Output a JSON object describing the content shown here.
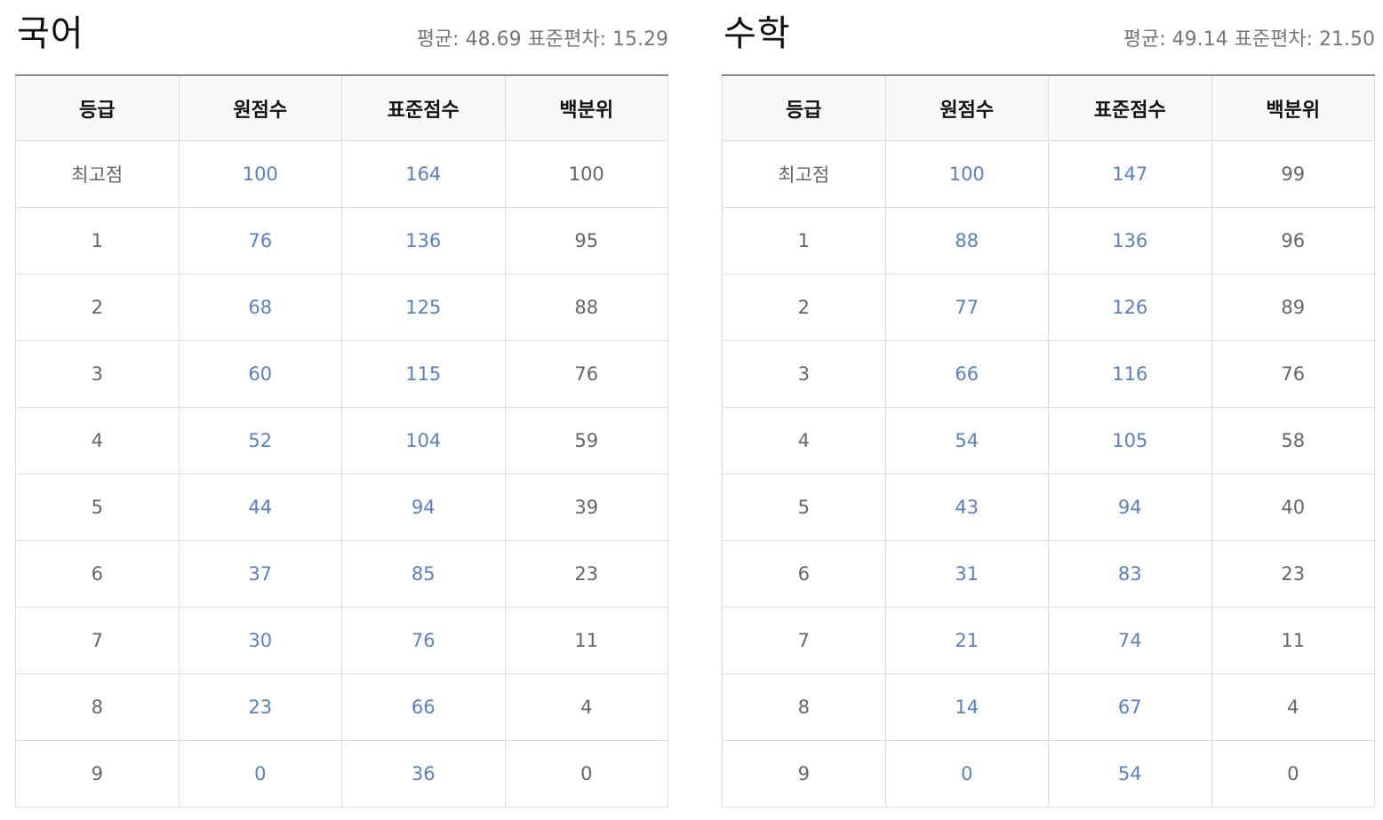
{
  "panels": [
    {
      "subject": "국어",
      "stats_mean_label": "평균: 48.69",
      "stats_sd_label": "표준편차: 15.29",
      "headers": [
        "등급",
        "원점수",
        "표준점수",
        "백분위"
      ],
      "rows": [
        [
          "최고점",
          "100",
          "164",
          "100"
        ],
        [
          "1",
          "76",
          "136",
          "95"
        ],
        [
          "2",
          "68",
          "125",
          "88"
        ],
        [
          "3",
          "60",
          "115",
          "76"
        ],
        [
          "4",
          "52",
          "104",
          "59"
        ],
        [
          "5",
          "44",
          "94",
          "39"
        ],
        [
          "6",
          "37",
          "85",
          "23"
        ],
        [
          "7",
          "30",
          "76",
          "11"
        ],
        [
          "8",
          "23",
          "66",
          "4"
        ],
        [
          "9",
          "0",
          "36",
          "0"
        ]
      ]
    },
    {
      "subject": "수학",
      "stats_mean_label": "평균: 49.14",
      "stats_sd_label": "표준편차: 21.50",
      "headers": [
        "등급",
        "원점수",
        "표준점수",
        "백분위"
      ],
      "rows": [
        [
          "최고점",
          "100",
          "147",
          "99"
        ],
        [
          "1",
          "88",
          "136",
          "96"
        ],
        [
          "2",
          "77",
          "126",
          "89"
        ],
        [
          "3",
          "66",
          "116",
          "76"
        ],
        [
          "4",
          "54",
          "105",
          "58"
        ],
        [
          "5",
          "43",
          "94",
          "40"
        ],
        [
          "6",
          "31",
          "83",
          "23"
        ],
        [
          "7",
          "21",
          "74",
          "11"
        ],
        [
          "8",
          "14",
          "67",
          "4"
        ],
        [
          "9",
          "0",
          "54",
          "0"
        ]
      ]
    }
  ],
  "colors": {
    "link_value": "#5b7fc4",
    "header_bg": "#f8f8f8",
    "border": "#dddddd",
    "header_rule": "#222222"
  }
}
